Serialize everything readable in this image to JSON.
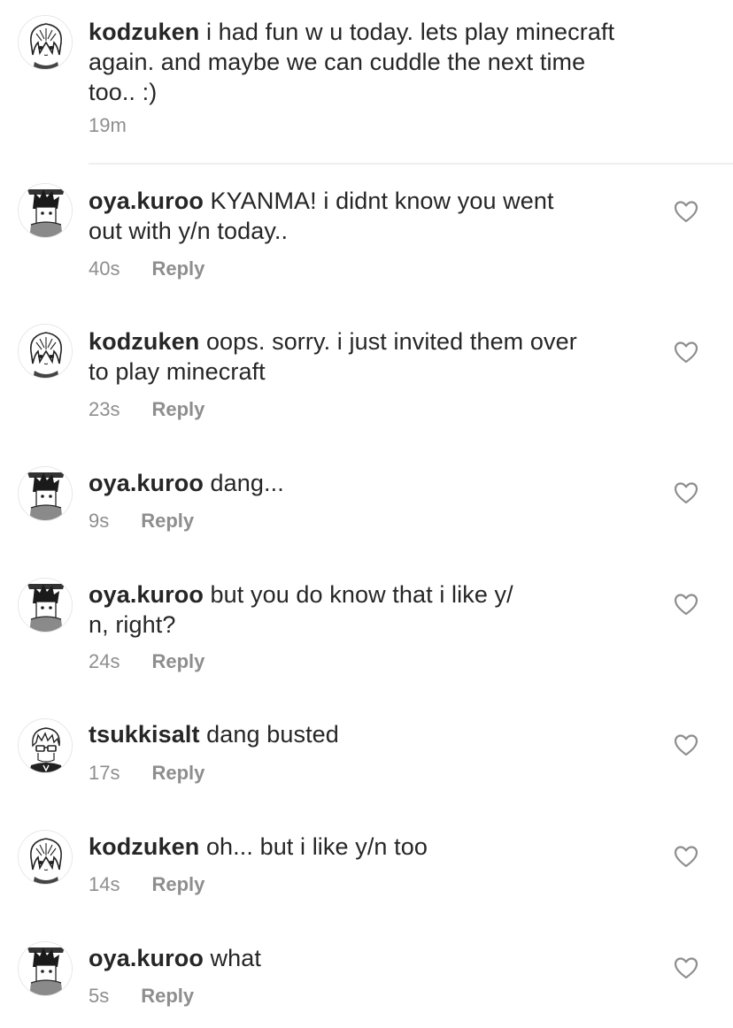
{
  "caption": {
    "username": "kodzuken",
    "text": "i had fun w u today. lets play minecraft again. and maybe we can cuddle the next time too.. :)",
    "line1": "i had fun w u today. lets play minecraft",
    "line2": "again. and maybe we can cuddle the next time",
    "line3": "too.. :)",
    "time": "19m",
    "avatar_icon": "kenma-avatar-icon"
  },
  "comments": [
    {
      "username": "oya.kuroo",
      "line1": "KYANMA! i didnt know you went",
      "line2": "out with y/n today..",
      "time": "40s",
      "reply_label": "Reply",
      "avatar_icon": "kuroo-avatar-icon"
    },
    {
      "username": "kodzuken",
      "line1": "oops. sorry. i just invited them over",
      "line2": "to play minecraft",
      "time": "23s",
      "reply_label": "Reply",
      "avatar_icon": "kenma-avatar-icon"
    },
    {
      "username": "oya.kuroo",
      "line1": "dang...",
      "line2": "",
      "time": "9s",
      "reply_label": "Reply",
      "avatar_icon": "kuroo-avatar-icon"
    },
    {
      "username": "oya.kuroo",
      "line1": "but you do know that i like y/",
      "line2": "n, right?",
      "time": "24s",
      "reply_label": "Reply",
      "avatar_icon": "kuroo-avatar-icon"
    },
    {
      "username": "tsukkisalt",
      "line1": "dang busted",
      "line2": "",
      "time": "17s",
      "reply_label": "Reply",
      "avatar_icon": "tsukki-avatar-icon"
    },
    {
      "username": "kodzuken",
      "line1": "oh... but i like y/n too",
      "line2": "",
      "time": "14s",
      "reply_label": "Reply",
      "avatar_icon": "kenma-avatar-icon"
    },
    {
      "username": "oya.kuroo",
      "line1": "what",
      "line2": "",
      "time": "5s",
      "reply_label": "Reply",
      "avatar_icon": "kuroo-avatar-icon"
    }
  ],
  "colors": {
    "text": "#262626",
    "meta": "#8e8e8e",
    "divider": "#efefef"
  }
}
